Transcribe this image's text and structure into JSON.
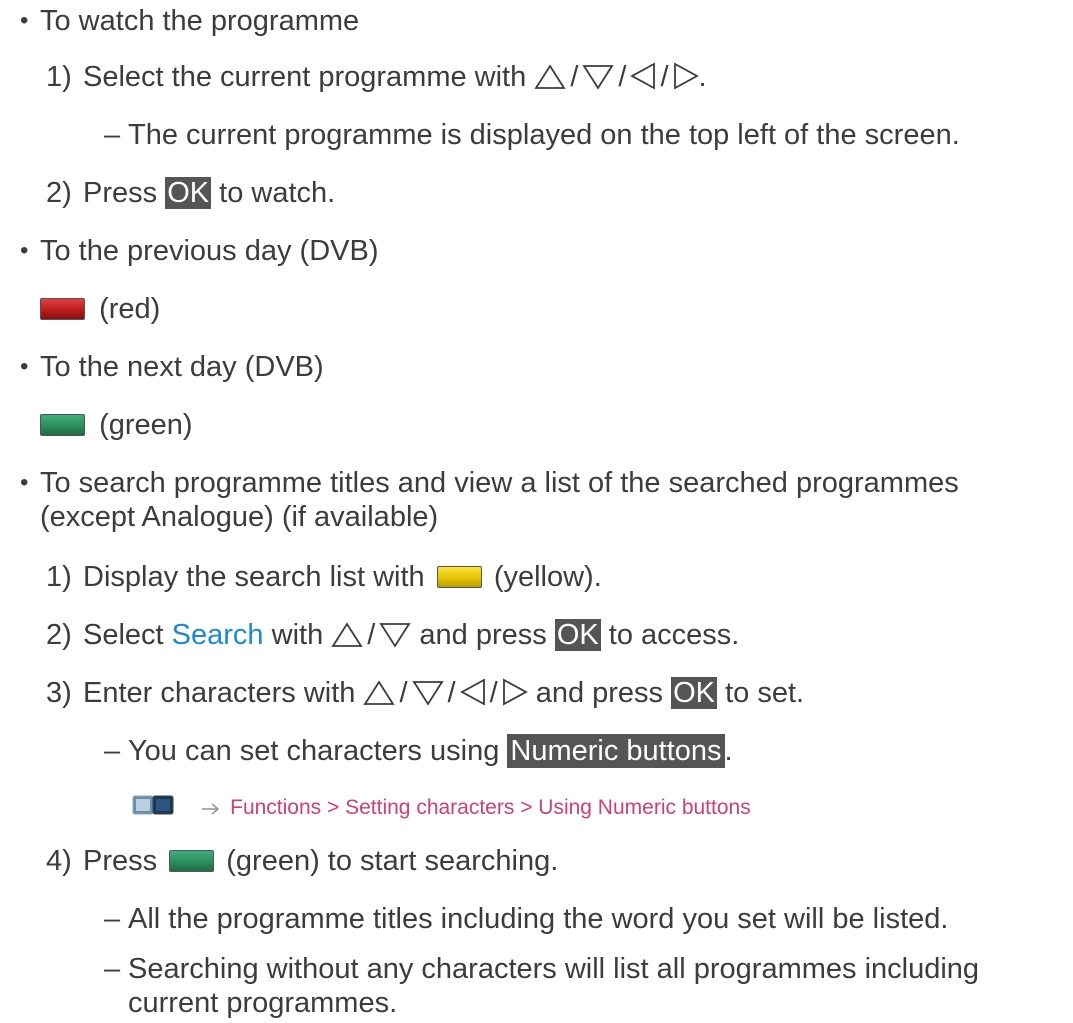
{
  "sections": {
    "watch": {
      "bullet": "•",
      "title": "To watch the programme",
      "step1": {
        "num": "1)",
        "text_before": "Select the current programme with",
        "end": "."
      },
      "step1_note": {
        "dash": "–",
        "text": "The current programme is displayed on the top left of the screen."
      },
      "step2": {
        "num": "2)",
        "before": "Press",
        "ok": "OK",
        "after": "to watch."
      }
    },
    "prev_day": {
      "bullet": "•",
      "title": "To the previous day (DVB)",
      "key_label": "(red)"
    },
    "next_day": {
      "bullet": "•",
      "title": "To the next day (DVB)",
      "key_label": "(green)"
    },
    "search": {
      "bullet": "•",
      "title": "To search programme titles and view a list of the searched programmes (except Analogue) (if available)",
      "step1": {
        "num": "1)",
        "before": "Display the search list with",
        "after": "(yellow)."
      },
      "step2": {
        "num": "2)",
        "before": "Select",
        "link": "Search",
        "mid": "with",
        "and": "and press",
        "ok": "OK",
        "after": "to access."
      },
      "step3": {
        "num": "3)",
        "before": "Enter characters with",
        "and": "and press",
        "ok": "OK",
        "after": "to set."
      },
      "step3_note": {
        "dash": "–",
        "before": "You can set characters using",
        "button": "Numeric buttons",
        "after": "."
      },
      "step3_ref": {
        "text": "Functions > Setting characters > Using Numeric buttons"
      },
      "step4": {
        "num": "4)",
        "before": "Press",
        "after": "(green) to start searching."
      },
      "step4_note1": {
        "dash": "–",
        "text": "All the programme titles including the word you set will be listed."
      },
      "step4_note2": {
        "dash": "–",
        "text": "Searching without any characters will list all programmes including current programmes."
      }
    }
  },
  "separators": {
    "slash": "/"
  },
  "icons": {
    "up": "triangle-up-icon",
    "down": "triangle-down-icon",
    "left": "triangle-left-icon",
    "right": "triangle-right-icon",
    "book": "ebook-reference-icon",
    "arrow": "arrow-right-icon"
  },
  "colors": {
    "text": "#3c3c3c",
    "ok_bg": "#555555",
    "link": "#1a8ad4",
    "reference": "#d04070",
    "key_red": "#c82020",
    "key_green": "#2a8a5a",
    "key_yellow": "#e0c000"
  }
}
